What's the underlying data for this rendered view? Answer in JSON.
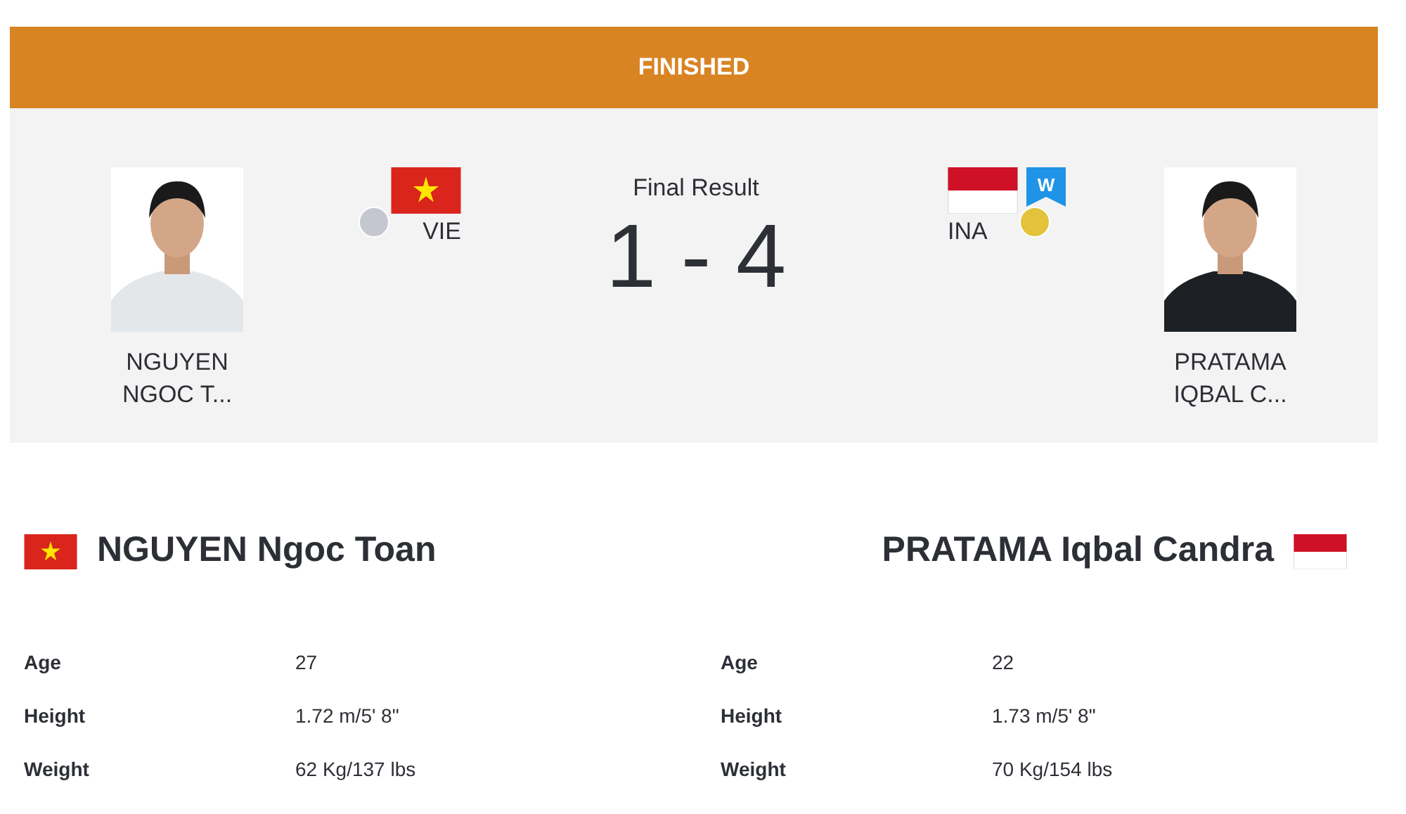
{
  "status": "FINISHED",
  "result_label": "Final Result",
  "score": "1 - 4",
  "athletes": [
    {
      "name_lines": [
        "NGUYEN",
        "NGOC T..."
      ],
      "code": "VIE",
      "kind": "vietnam",
      "color": "#c4c6d0",
      "winner": false,
      "full_name": "NGUYEN Ngoc Toan",
      "stats": [
        {
          "label": "Age",
          "value": "27"
        },
        {
          "label": "Height",
          "value": "1.72 m/5' 8\""
        },
        {
          "label": "Weight",
          "value": "62 Kg/137 lbs"
        }
      ]
    },
    {
      "name_lines": [
        "PRATAMA",
        "IQBAL C..."
      ],
      "code": "INA",
      "kind": "indonesia",
      "color": "#e3c33b",
      "winner": true,
      "winner_mark": "W",
      "full_name": "PRATAMA Iqbal Candra",
      "stats": [
        {
          "label": "Age",
          "value": "22"
        },
        {
          "label": "Height",
          "value": "1.73 m/5' 8\""
        },
        {
          "label": "Weight",
          "value": "70 Kg/154 lbs"
        }
      ]
    }
  ]
}
